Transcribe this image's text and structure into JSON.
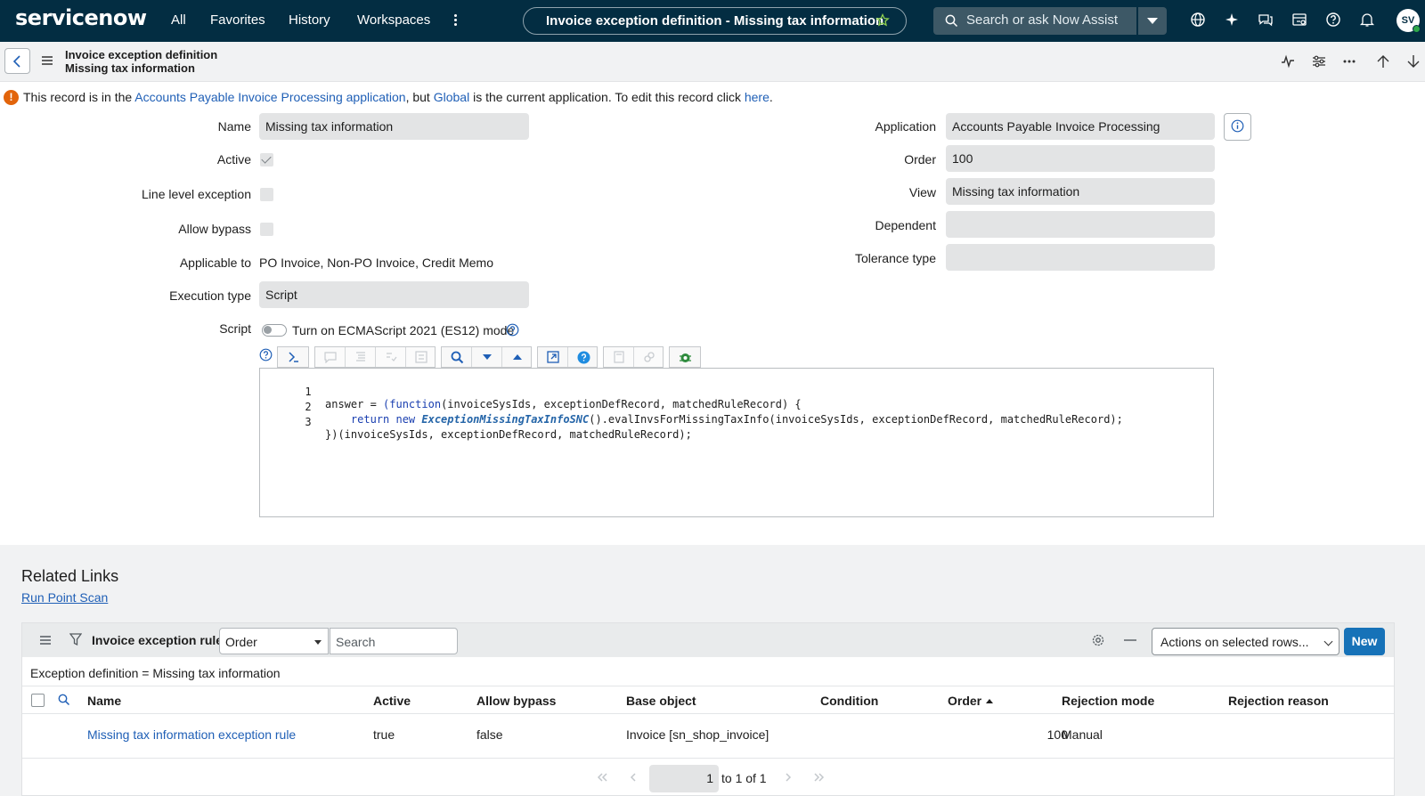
{
  "topnav": {
    "logo": "servicenow",
    "links": [
      "All",
      "Favorites",
      "History",
      "Workspaces"
    ],
    "record_title": "Invoice exception definition - Missing tax information",
    "search_placeholder": "Search or ask Now Assist",
    "avatar_initials": "SV",
    "bg_color": "#032d42"
  },
  "header": {
    "line1": "Invoice exception definition",
    "line2": "Missing tax information"
  },
  "banner": {
    "part1": "This record is in the ",
    "app_link": "Accounts Payable Invoice Processing",
    "part2": " application",
    "part3": ", but ",
    "global_link": "Global",
    "part4": " is the current application. To edit this record click ",
    "here_link": "here",
    "part5": "."
  },
  "form": {
    "name_label": "Name",
    "name_value": "Missing tax information",
    "active_label": "Active",
    "active_checked": true,
    "line_level_label": "Line level exception",
    "allow_bypass_label": "Allow bypass",
    "applicable_label": "Applicable to",
    "applicable_value": "PO Invoice, Non-PO Invoice, Credit Memo",
    "execution_type_label": "Execution type",
    "execution_type_value": "Script",
    "script_label": "Script",
    "es12_label": "Turn on ECMAScript 2021 (ES12) mode",
    "application_label": "Application",
    "application_value": "Accounts Payable Invoice Processing",
    "order_label": "Order",
    "order_value": "100",
    "view_label": "View",
    "view_value": "Missing tax information",
    "dependent_label": "Dependent",
    "dependent_value": "",
    "tolerance_label": "Tolerance type",
    "tolerance_value": ""
  },
  "code": {
    "line_numbers": [
      "1",
      "2",
      "3"
    ],
    "l1_a": "answer = ",
    "l1_b": "(function",
    "l1_c": "(invoiceSysIds, exceptionDefRecord, matchedRuleRecord) {",
    "l2_a": "    return new ",
    "l2_b": "ExceptionMissingTaxInfoSNC",
    "l2_c": "().evalInvsForMissingTaxInfo(invoiceSysIds, exceptionDefRecord, matchedRuleRecord);",
    "l3": "})(invoiceSysIds, exceptionDefRecord, matchedRuleRecord);"
  },
  "related": {
    "title": "Related Links",
    "link": "Run Point Scan"
  },
  "list": {
    "title": "Invoice exception rules",
    "sort_select": "Order",
    "search_placeholder": "Search",
    "actions_label": "Actions on selected rows...",
    "new_label": "New",
    "filter": "Exception definition = Missing tax information",
    "columns": [
      "Name",
      "Active",
      "Allow bypass",
      "Base object",
      "Condition",
      "Order",
      "Rejection mode",
      "Rejection reason"
    ],
    "rows": [
      {
        "name": "Missing tax information exception rule",
        "active": "true",
        "allow_bypass": "false",
        "base_object": "Invoice [sn_shop_invoice]",
        "condition": "",
        "order": "100",
        "rejection_mode": "Manual",
        "rejection_reason": ""
      }
    ],
    "pager_current": "1",
    "pager_text": "to 1 of 1"
  }
}
